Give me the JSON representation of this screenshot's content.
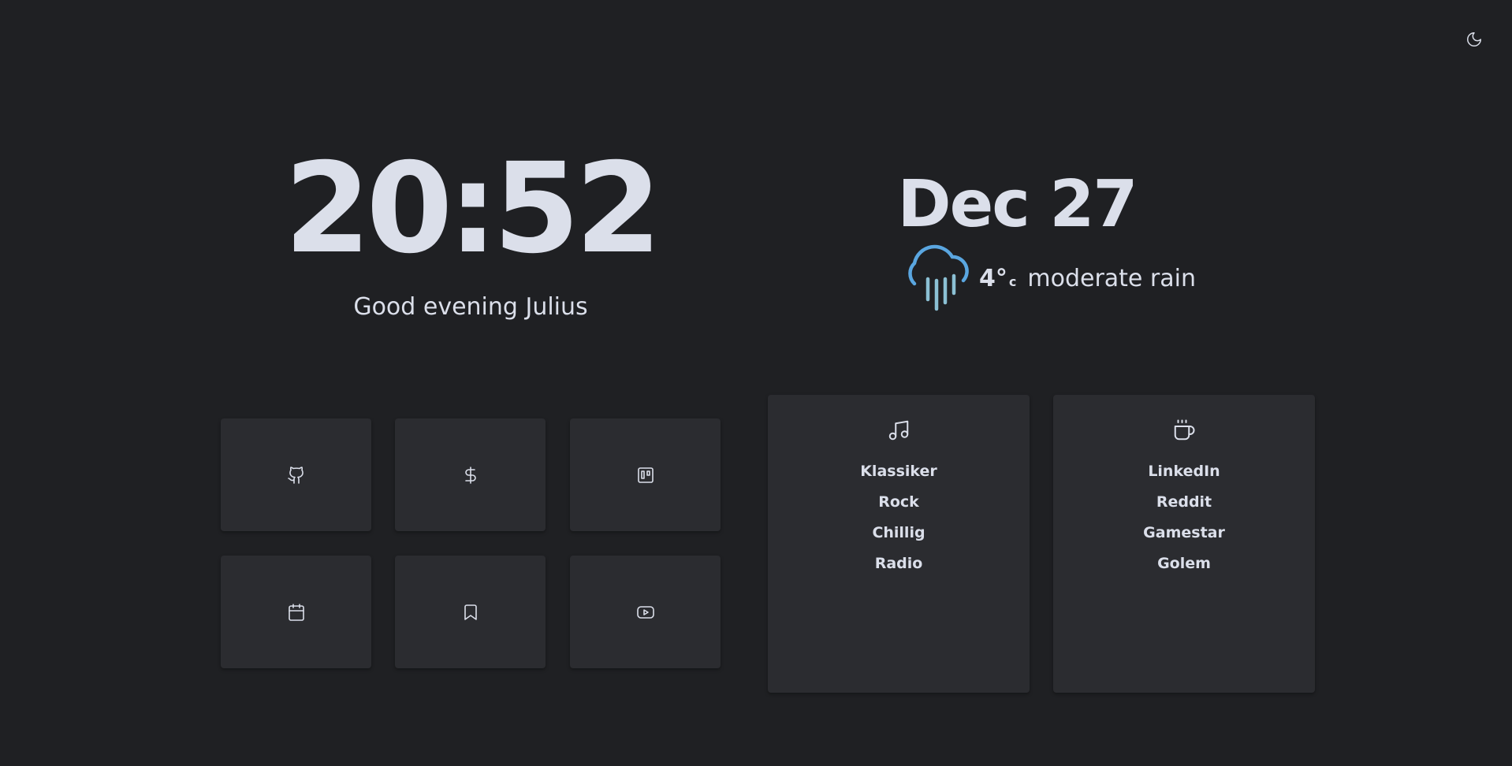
{
  "clock": {
    "time": "20:52",
    "greeting": "Good evening Julius"
  },
  "date": {
    "label": "Dec 27"
  },
  "weather": {
    "temperature": "4°",
    "unit": "c",
    "condition": "moderate rain",
    "icon": "rain-cloud-icon"
  },
  "theme_toggle": {
    "icon": "moon-icon"
  },
  "tiles": [
    {
      "icon": "github-icon"
    },
    {
      "icon": "dollar-icon"
    },
    {
      "icon": "trello-icon"
    },
    {
      "icon": "calendar-icon"
    },
    {
      "icon": "bookmark-icon"
    },
    {
      "icon": "youtube-icon"
    }
  ],
  "music_card": {
    "icon": "music-note-icon",
    "links": [
      "Klassiker",
      "Rock",
      "Chillig",
      "Radio"
    ]
  },
  "news_card": {
    "icon": "coffee-cup-icon",
    "links": [
      "LinkedIn",
      "Reddit",
      "Gamestar",
      "Golem"
    ]
  },
  "colors": {
    "background": "#1f2023",
    "tile": "#2b2c30",
    "text": "#dbdfea",
    "rain_cloud": "#5aa6e0",
    "rain_drops": "#8bc0d4"
  }
}
